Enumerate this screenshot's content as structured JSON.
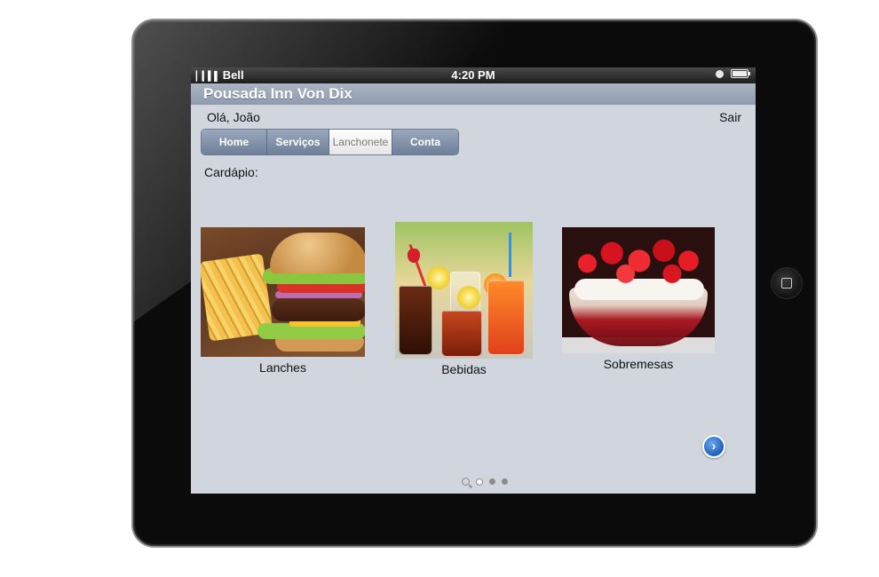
{
  "status_bar": {
    "signal": "▏▎▍▌",
    "carrier": "Bell",
    "time": "4:20 PM"
  },
  "app": {
    "title": "Pousada Inn Von Dix"
  },
  "header": {
    "greeting": "Olá, João",
    "logout_label": "Sair"
  },
  "tabs": [
    {
      "label": "Home",
      "active": false
    },
    {
      "label": "Serviços",
      "active": false
    },
    {
      "label": "Lanchonete",
      "active": true
    },
    {
      "label": "Conta",
      "active": false
    }
  ],
  "menu": {
    "label": "Cardápio:",
    "items": [
      {
        "caption": "Lanches",
        "image": "burger-and-fries"
      },
      {
        "caption": "Bebidas",
        "image": "drinks"
      },
      {
        "caption": "Sobremesas",
        "image": "strawberry-dessert"
      }
    ]
  },
  "pagination": {
    "pages": 3,
    "current": 1
  },
  "icons": {
    "next": "chevron-right-circle-icon",
    "search": "search-icon"
  },
  "colors": {
    "screen_bg": "#d1d6de",
    "tab_bar": "#6e7f99",
    "accent_next": "#1f5fb8"
  }
}
